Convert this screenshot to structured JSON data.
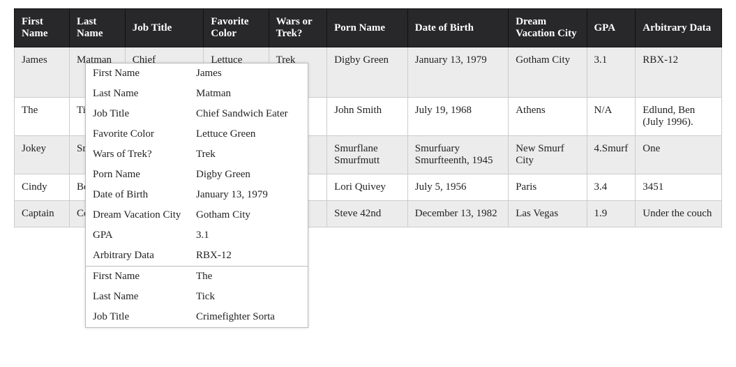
{
  "table": {
    "headers": [
      "First Name",
      "Last Name",
      "Job Title",
      "Favorite Color",
      "Wars or Trek?",
      "Porn Name",
      "Date of Birth",
      "Dream Vacation City",
      "GPA",
      "Arbitrary Data"
    ],
    "rows": [
      [
        "James",
        "Matman",
        "Chief Sandwich Eater",
        "Lettuce Green",
        "Trek",
        "Digby Green",
        "January 13, 1979",
        "Gotham City",
        "3.1",
        "RBX-12"
      ],
      [
        "The",
        "Ti",
        "",
        "",
        "",
        "John Smith",
        "July 19, 1968",
        "Athens",
        "N/A",
        "Edlund, Ben (July 1996)."
      ],
      [
        "Jokey",
        "Sm",
        "",
        "",
        "",
        "Smurflane Smurfmutt",
        "Smurfuary Smurfteenth, 1945",
        "New Smurf City",
        "4.Smurf",
        "One"
      ],
      [
        "Cindy",
        "Be",
        "",
        "",
        "",
        "Lori Quivey",
        "July 5, 1956",
        "Paris",
        "3.4",
        "3451"
      ],
      [
        "Captain",
        "Co",
        "",
        "",
        "",
        "Steve 42nd",
        "December 13, 1982",
        "Las Vegas",
        "1.9",
        "Under the couch"
      ]
    ]
  },
  "overlay": {
    "groups": [
      [
        {
          "k": "First Name",
          "v": "James"
        },
        {
          "k": "Last Name",
          "v": "Matman"
        },
        {
          "k": "Job Title",
          "v": "Chief Sandwich Eater"
        },
        {
          "k": "Favorite Color",
          "v": "Lettuce Green"
        },
        {
          "k": "Wars of Trek?",
          "v": "Trek"
        },
        {
          "k": "Porn Name",
          "v": "Digby Green"
        },
        {
          "k": "Date of Birth",
          "v": "January 13, 1979"
        },
        {
          "k": "Dream Vacation City",
          "v": "Gotham City"
        },
        {
          "k": "GPA",
          "v": "3.1"
        },
        {
          "k": "Arbitrary Data",
          "v": "RBX-12"
        }
      ],
      [
        {
          "k": "First Name",
          "v": "The"
        },
        {
          "k": "Last Name",
          "v": "Tick"
        },
        {
          "k": "Job Title",
          "v": "Crimefighter Sorta"
        }
      ]
    ]
  }
}
